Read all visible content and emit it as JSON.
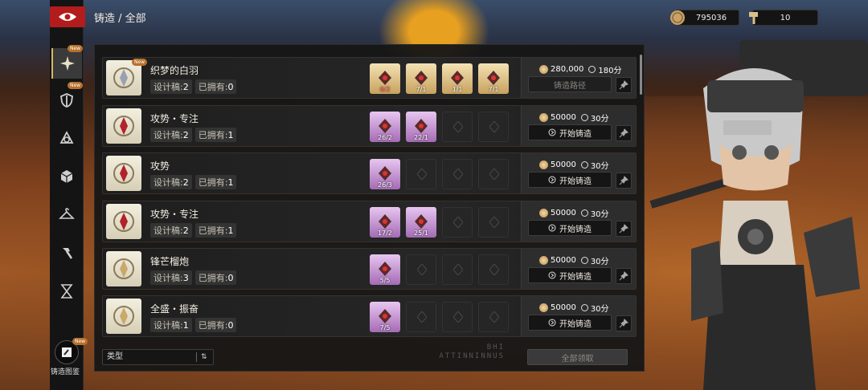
{
  "header": {
    "title": "铸造 / 全部"
  },
  "currencies": [
    {
      "name": "coin",
      "value": "795036"
    },
    {
      "name": "hammer",
      "value": "10"
    }
  ],
  "sidebar": {
    "new_badge": "New",
    "items": [
      {
        "icon": "feather-star-icon",
        "new": true,
        "active": true
      },
      {
        "icon": "shield-sword-icon",
        "new": true
      },
      {
        "icon": "triquetra-icon"
      },
      {
        "icon": "cube-icon"
      },
      {
        "icon": "hanger-icon"
      },
      {
        "icon": "hammer-icon"
      },
      {
        "icon": "hourglass-icon"
      }
    ],
    "codex_label": "铸造图鉴"
  },
  "labels": {
    "blueprint": "设计稿:",
    "owned": "已拥有:",
    "new": "New"
  },
  "items": [
    {
      "name": "织梦的白羽",
      "blueprint": "2",
      "owned": "0",
      "new": true,
      "materials": [
        {
          "count": "0/2",
          "short": true,
          "color": "gold"
        },
        {
          "count": "7/1",
          "color": "gold"
        },
        {
          "count": "1/1",
          "color": "gold"
        },
        {
          "count": "7/1",
          "color": "gold"
        }
      ],
      "price": "280,000",
      "time": "180分",
      "action": "铸造路径",
      "action_disabled": true
    },
    {
      "name": "攻势・专注",
      "blueprint": "2",
      "owned": "1",
      "materials": [
        {
          "count": "26/2",
          "color": "purple"
        },
        {
          "count": "22/1",
          "color": "purple"
        }
      ],
      "price": "50000",
      "time": "30分",
      "action": "开始铸造"
    },
    {
      "name": "攻势",
      "blueprint": "2",
      "owned": "1",
      "materials": [
        {
          "count": "26/3",
          "color": "purple"
        }
      ],
      "price": "50000",
      "time": "30分",
      "action": "开始铸造"
    },
    {
      "name": "攻势・专注",
      "blueprint": "2",
      "owned": "1",
      "materials": [
        {
          "count": "17/2",
          "color": "purple"
        },
        {
          "count": "25/1",
          "color": "purple"
        }
      ],
      "price": "50000",
      "time": "30分",
      "action": "开始铸造"
    },
    {
      "name": "锋芒榴炮",
      "blueprint": "3",
      "owned": "0",
      "materials": [
        {
          "count": "5/5",
          "color": "purple"
        }
      ],
      "price": "50000",
      "time": "30分",
      "action": "开始铸造"
    },
    {
      "name": "全盛・振奋",
      "blueprint": "1",
      "owned": "0",
      "materials": [
        {
          "count": "7/5",
          "color": "purple"
        }
      ],
      "price": "50000",
      "time": "30分",
      "action": "开始铸造"
    }
  ],
  "footer": {
    "filter_label": "类型",
    "watermark": "BHI ATTINNINNUS",
    "claim_all": "全部领取"
  }
}
